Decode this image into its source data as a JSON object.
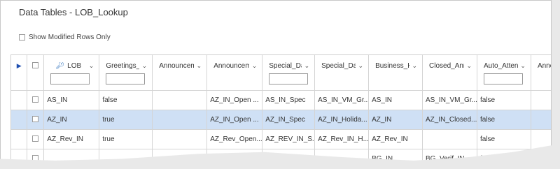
{
  "title": "Data Tables - LOB_Lookup",
  "show_modified": {
    "label": "Show Modified Rows Only",
    "checked": false
  },
  "columns": [
    {
      "label": "LOB",
      "key_icon": true
    },
    {
      "label": "Greetings_Ac..."
    },
    {
      "label": "Announceme..."
    },
    {
      "label": "Announceme..."
    },
    {
      "label": "Special_Days..."
    },
    {
      "label": "Special_Days..."
    },
    {
      "label": "Business_Ho..."
    },
    {
      "label": "Closed_Annc"
    },
    {
      "label": "Auto_Attend..."
    },
    {
      "label": "Announceme..."
    }
  ],
  "rows": [
    {
      "selected": false,
      "cells": [
        "AS_IN",
        "false",
        "",
        "AZ_IN_Open ...",
        "AS_IN_Spec",
        "AS_IN_VM_Gr...",
        "AS_IN",
        "AS_IN_VM_Gr...",
        "false",
        ""
      ]
    },
    {
      "selected": true,
      "cells": [
        "AZ_IN",
        "true",
        "",
        "AZ_IN_Open ...",
        "AZ_IN_Spec",
        "AZ_IN_Holida...",
        "AZ_IN",
        "AZ_IN_Closed...",
        "false",
        ""
      ]
    },
    {
      "selected": false,
      "cells": [
        "AZ_Rev_IN",
        "true",
        "",
        "AZ_Rev_Open...",
        "AZ_REV_IN_S...",
        "AZ_Rev_IN_H...",
        "AZ_Rev_IN",
        "",
        "false",
        ""
      ]
    },
    {
      "selected": false,
      "cells": [
        "",
        "",
        "",
        "",
        "BG_IN_Spec",
        "",
        "BG_IN",
        "BG_Verif_IN_...",
        "false",
        ""
      ]
    }
  ]
}
